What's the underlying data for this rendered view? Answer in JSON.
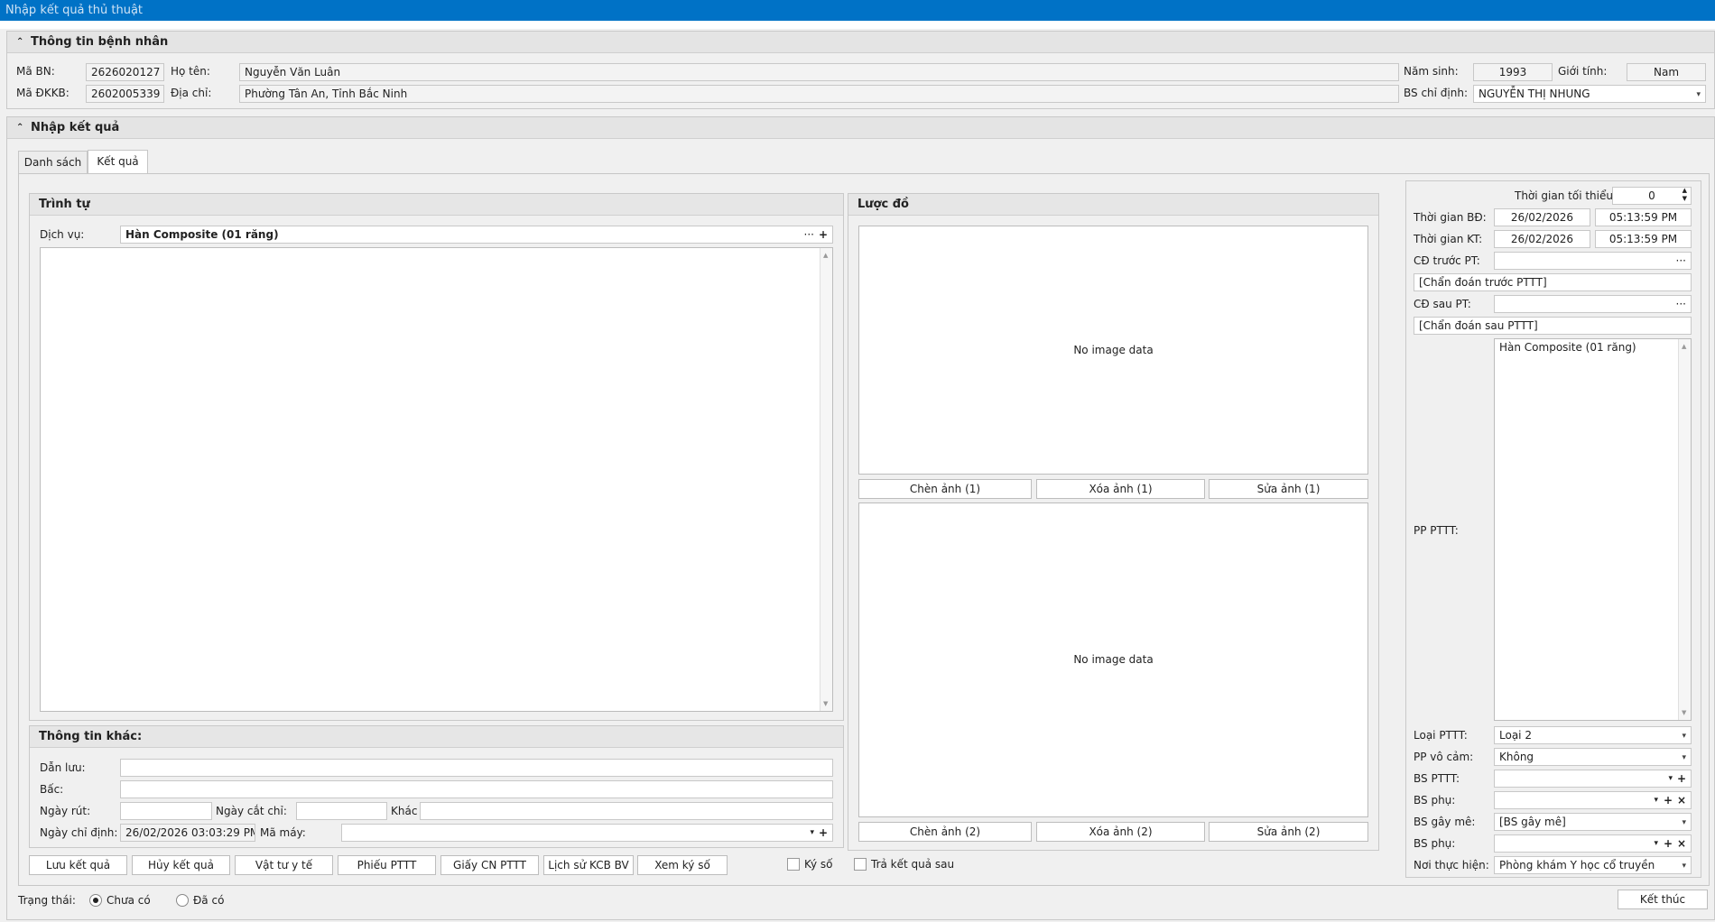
{
  "window": {
    "title": "Nhập kết quả thủ thuật"
  },
  "patient": {
    "header": "Thông tin bệnh nhân",
    "ma_bn_label": "Mã BN:",
    "ma_bn": "2626020127",
    "ho_ten_label": "Họ tên:",
    "ho_ten": "Nguyễn Văn Luân",
    "nam_sinh_label": "Năm sinh:",
    "nam_sinh": "1993",
    "gioi_tinh_label": "Giới tính:",
    "gioi_tinh": "Nam",
    "ma_dkkb_label": "Mã ĐKKB:",
    "ma_dkkb": "2602005339",
    "dia_chi_label": "Địa chỉ:",
    "dia_chi": "Phường Tân An, Tỉnh Bắc Ninh",
    "bs_chi_dinh_label": "BS chỉ định:",
    "bs_chi_dinh": "NGUYỄN THỊ NHUNG"
  },
  "result": {
    "header": "Nhập kết quả",
    "tabs": [
      {
        "label": "Danh sách"
      },
      {
        "label": "Kết quả"
      }
    ]
  },
  "trinh_tu": {
    "header": "Trình tự",
    "dich_vu_label": "Dịch vụ:",
    "dich_vu": "Hàn Composite (01 răng)"
  },
  "other": {
    "header": "Thông tin khác:",
    "dan_luu_label": "Dẫn lưu:",
    "dan_luu": "",
    "bac_label": "Bấc:",
    "bac": "",
    "ngay_rut_label": "Ngày rút:",
    "ngay_rut": "",
    "ngay_cat_chi_label": "Ngày cắt chỉ:",
    "ngay_cat_chi": "",
    "khac_label": "Khác",
    "khac": "",
    "ngay_chi_dinh_label": "Ngày chỉ định:",
    "ngay_chi_dinh": "26/02/2026 03:03:29 PM",
    "ma_may_label": "Mã máy:",
    "ma_may": ""
  },
  "luoc_do": {
    "header": "Lược đồ",
    "no_image_1": "No image data",
    "no_image_2": "No image data",
    "chen_anh_1": "Chèn ảnh (1)",
    "xoa_anh_1": "Xóa ảnh (1)",
    "sua_anh_1": "Sửa ảnh (1)",
    "chen_anh_2": "Chèn ảnh (2)",
    "xoa_anh_2": "Xóa ảnh (2)",
    "sua_anh_2": "Sửa ảnh (2)"
  },
  "right": {
    "tg_toi_thieu_label": "Thời gian tối thiểu:",
    "tg_toi_thieu": "0",
    "tg_bd_label": "Thời gian BĐ:",
    "tg_bd_date": "26/02/2026",
    "tg_bd_time": "05:13:59 PM",
    "tg_kt_label": "Thời gian KT:",
    "tg_kt_date": "26/02/2026",
    "tg_kt_time": "05:13:59 PM",
    "cd_truoc_label": "CĐ trước PT:",
    "cd_truoc": "",
    "cd_truoc_text": "[Chẩn đoán trước PTTT]",
    "cd_sau_label": "CĐ sau PT:",
    "cd_sau": "",
    "cd_sau_text": "[Chẩn đoán sau PTTT]",
    "pp_pttt_label": "PP PTTT:",
    "pp_pttt": "Hàn Composite (01 răng)",
    "loai_pttt_label": "Loại PTTT:",
    "loai_pttt": "Loại 2",
    "pp_vo_cam_label": "PP vô cảm:",
    "pp_vo_cam": "Không",
    "bs_pttt_label": "BS PTTT:",
    "bs_pttt": "",
    "bs_phu_label": "BS phụ:",
    "bs_phu": "",
    "bs_gay_me_label": "BS gây mê:",
    "bs_gay_me": "[BS gây mê]",
    "bs_phu2_label": "BS phụ:",
    "bs_phu2": "",
    "noi_thuc_hien_label": "Nơi thực hiện:",
    "noi_thuc_hien": "Phòng khám Y học cổ truyền"
  },
  "actions": {
    "luu": "Lưu kết quả",
    "huy": "Hủy kết quả",
    "vat_tu": "Vật tư y tế",
    "phieu": "Phiếu PTTT",
    "giay": "Giấy CN PTTT",
    "lich_su": "Lịch sử KCB BV",
    "xem_ky_so": "Xem ký số",
    "ky_so": "Ký số",
    "tra_ket_qua": "Trả kết quả sau"
  },
  "status": {
    "label": "Trạng thái:",
    "chua_co": "Chưa có",
    "da_co": "Đã có",
    "ket_thuc": "Kết thúc"
  },
  "icons": {
    "ellipsis": "···",
    "plus": "+",
    "dropdown": "▾",
    "close": "×",
    "collapse": "⌃"
  }
}
